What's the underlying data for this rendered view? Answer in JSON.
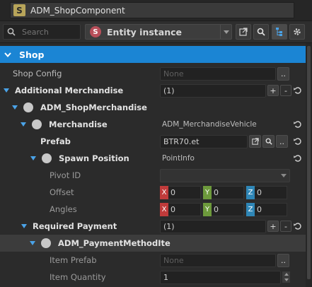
{
  "window": {
    "title": "ADM_ShopComponent",
    "icon_letter": "S"
  },
  "toolbar": {
    "search_placeholder": "Search",
    "entity_mode": "Entity instance",
    "entity_icon_letter": "S"
  },
  "section": {
    "title": "Shop"
  },
  "rows": {
    "shop_config": {
      "label": "Shop Config",
      "value_placeholder": "None",
      "button": ".."
    },
    "additional_merchandise": {
      "label": "Additional Merchandise",
      "value": "(1)",
      "add": "+",
      "remove": "-"
    },
    "adm_shop_merchandise": {
      "label": "ADM_ShopMerchandise"
    },
    "merchandise": {
      "label": "Merchandise",
      "value": "ADM_MerchandiseVehicle"
    },
    "prefab": {
      "label": "Prefab",
      "value": "BTR70.et"
    },
    "spawn_position": {
      "label": "Spawn Position",
      "value": "PointInfo"
    },
    "pivot_id": {
      "label": "Pivot ID",
      "value": ""
    },
    "offset": {
      "label": "Offset",
      "x": "0",
      "y": "0",
      "z": "0"
    },
    "angles": {
      "label": "Angles",
      "x": "0",
      "y": "0",
      "z": "0"
    },
    "required_payment": {
      "label": "Required Payment",
      "value": "(1)",
      "add": "+",
      "remove": "-"
    },
    "payment_method": {
      "label": "ADM_PaymentMethodIte"
    },
    "item_prefab": {
      "label": "Item Prefab",
      "value_placeholder": "None",
      "button": ".."
    },
    "item_quantity": {
      "label": "Item Quantity",
      "value": "1"
    }
  },
  "axes": {
    "x": "X",
    "y": "Y",
    "z": "Z"
  },
  "colors": {
    "accent": "#1b85d4",
    "axis_x": "#c03b3b",
    "axis_y": "#6d9a3c",
    "axis_z": "#2f86b6"
  }
}
